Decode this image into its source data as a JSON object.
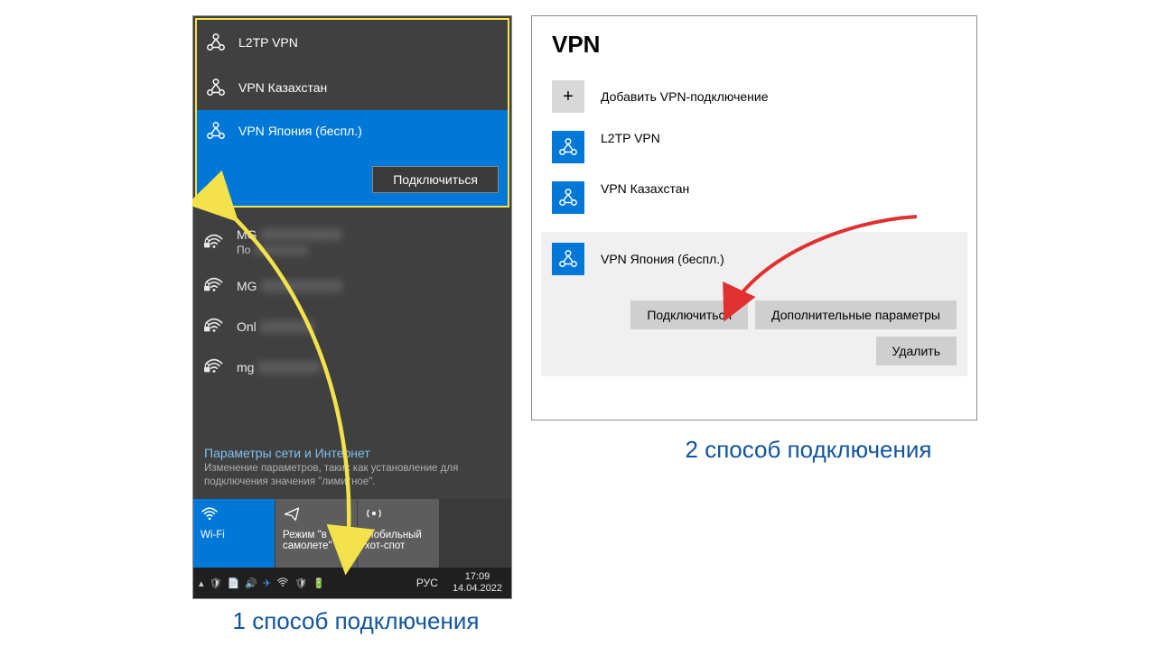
{
  "flyout": {
    "vpn_items": [
      {
        "label": "L2TP VPN"
      },
      {
        "label": "VPN Казахстан"
      },
      {
        "label": "VPN Япония (беспл.)"
      }
    ],
    "connect_btn": "Подключиться",
    "wifi": [
      {
        "name": "MG",
        "sub": "По",
        "masked": true
      },
      {
        "name": "MG",
        "masked": true
      },
      {
        "name": "Onl",
        "masked": true
      },
      {
        "name": "mg",
        "masked": true
      }
    ],
    "settings_title": "Параметры сети и Интернет",
    "settings_desc": "Изменение параметров, таких как установление для подключения значения \"лимитное\".",
    "tiles": {
      "wifi": "Wi-Fi",
      "airplane": "Режим \"в самолете\"",
      "hotspot": "Мобильный хот-спот"
    },
    "taskbar": {
      "lang": "РУС",
      "time": "17:09",
      "date": "14.04.2022"
    }
  },
  "settings": {
    "title": "VPN",
    "add_label": "Добавить VPN-подключение",
    "connections": [
      "L2TP VPN",
      "VPN Казахстан",
      "VPN Япония (беспл.)"
    ],
    "btn_connect": "Подключиться",
    "btn_advanced": "Дополнительные параметры",
    "btn_delete": "Удалить"
  },
  "captions": {
    "c1": "1 способ подключения",
    "c2": "2 способ подключения"
  }
}
